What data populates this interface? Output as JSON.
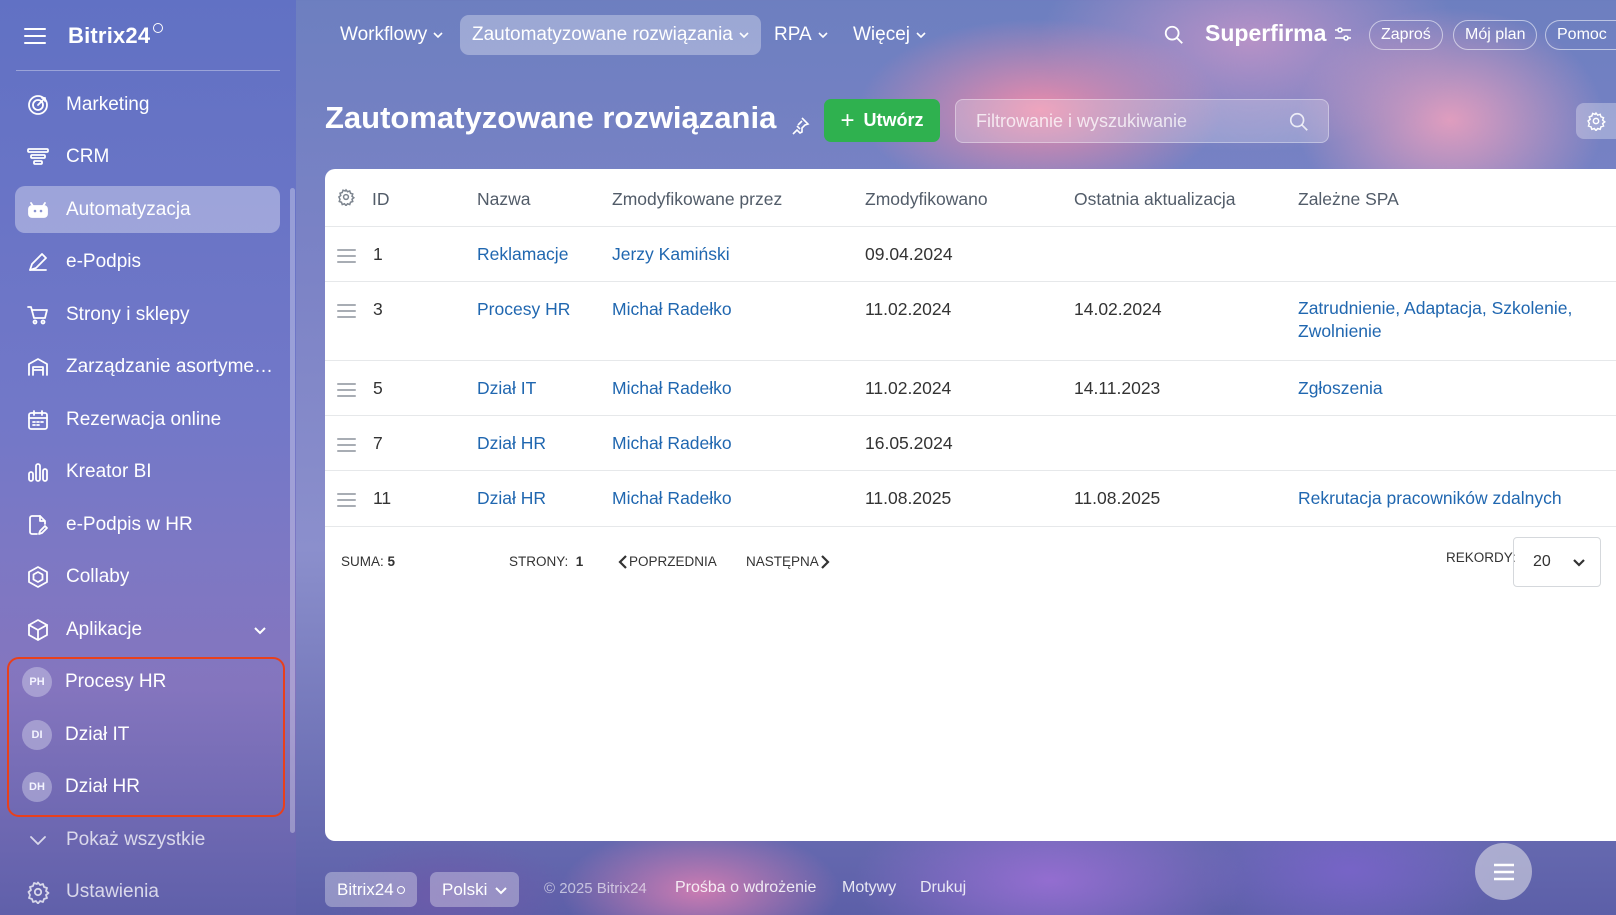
{
  "sidebar": {
    "logo": "Bitrix24",
    "items": [
      {
        "label": "Marketing",
        "icon": "target-icon"
      },
      {
        "label": "CRM",
        "icon": "funnel-icon"
      },
      {
        "label": "Automatyzacja",
        "icon": "robot-icon",
        "active": true
      },
      {
        "label": "e-Podpis",
        "icon": "pen-icon"
      },
      {
        "label": "Strony i sklepy",
        "icon": "cart-icon"
      },
      {
        "label": "Zarządzanie asortymen...",
        "icon": "warehouse-icon"
      },
      {
        "label": "Rezerwacja online",
        "icon": "calendar-icon"
      },
      {
        "label": "Kreator BI",
        "icon": "bar-chart-icon"
      },
      {
        "label": "e-Podpis w HR",
        "icon": "document-pen-icon"
      },
      {
        "label": "Collaby",
        "icon": "hexagon-icon"
      },
      {
        "label": "Aplikacje",
        "icon": "box-icon"
      }
    ],
    "apps": [
      {
        "initials": "PH",
        "label": "Procesy HR"
      },
      {
        "initials": "DI",
        "label": "Dział IT"
      },
      {
        "initials": "DH",
        "label": "Dział HR"
      }
    ],
    "show_all": "Pokaż wszystkie",
    "settings": "Ustawienia"
  },
  "topbar": {
    "tabs": [
      "Workflowy",
      "Zautomatyzowane rozwiązania",
      "RPA",
      "Więcej"
    ],
    "company": "Superfirma",
    "invite": "Zaproś",
    "plan": "Mój plan",
    "help": "Pomoc"
  },
  "page": {
    "title": "Zautomatyzowane rozwiązania",
    "create_label": "Utwórz",
    "filter_placeholder": "Filtrowanie i wyszukiwanie"
  },
  "table": {
    "columns": [
      "ID",
      "Nazwa",
      "Zmodyfikowane przez",
      "Zmodyfikowano",
      "Ostatnia aktualizacja",
      "Zależne SPA"
    ],
    "rows": [
      {
        "id": "1",
        "name": "Reklamacje",
        "modified_by": "Jerzy Kamiński",
        "modified": "09.04.2024",
        "last_update": "",
        "spa": ""
      },
      {
        "id": "3",
        "name": "Procesy HR",
        "modified_by": "Michał Radełko",
        "modified": "11.02.2024",
        "last_update": "14.02.2024",
        "spa": "Zatrudnienie, Adaptacja, Szkolenie, Zwolnienie"
      },
      {
        "id": "5",
        "name": "Dział IT",
        "modified_by": "Michał Radełko",
        "modified": "11.02.2024",
        "last_update": "14.11.2023",
        "spa": "Zgłoszenia"
      },
      {
        "id": "7",
        "name": "Dział HR",
        "modified_by": "Michał Radełko",
        "modified": "16.05.2024",
        "last_update": "",
        "spa": ""
      },
      {
        "id": "11",
        "name": "Dział HR",
        "modified_by": "Michał Radełko",
        "modified": "11.08.2025",
        "last_update": "11.08.2025",
        "spa": "Rekrutacja pracowników zdalnych"
      }
    ],
    "footer": {
      "sum_label": "SUMA:",
      "sum_value": "5",
      "pages_label": "STRONY:",
      "pages_value": "1",
      "prev": "POPRZEDNIA",
      "next": "NASTĘPNA",
      "records_label": "REKORDY:",
      "records_value": "20"
    }
  },
  "footer": {
    "brand": "Bitrix24",
    "language": "Polski",
    "copyright": "© 2025 Bitrix24",
    "links": [
      "Prośba o wdrożenie",
      "Motywy",
      "Drukuj"
    ]
  },
  "colors": {
    "accent_green": "#2fb14f",
    "link_blue": "#2067b0",
    "highlight_red": "#e8401c"
  }
}
